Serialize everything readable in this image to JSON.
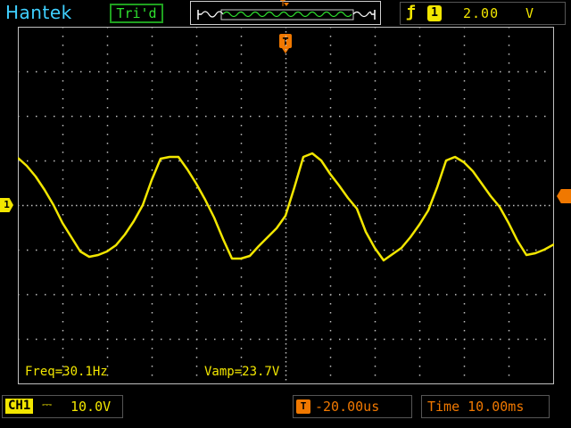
{
  "header": {
    "brand": "Hantek",
    "status": "Tri'd",
    "trigger_pos_icon": "T",
    "trigger": {
      "slope_icon": "rising-edge-icon",
      "slope_glyph": "ƒ",
      "channel": "1",
      "level": "2.00",
      "unit": "V"
    }
  },
  "screen": {
    "background": "#000000",
    "grid_color": "#bfbfbf",
    "trace_color": "#f2e600",
    "trace": [
      [
        0,
        147
      ],
      [
        10,
        156
      ],
      [
        20,
        168
      ],
      [
        30,
        183
      ],
      [
        40,
        200
      ],
      [
        50,
        220
      ],
      [
        60,
        236
      ],
      [
        70,
        252
      ],
      [
        80,
        258
      ],
      [
        90,
        256
      ],
      [
        100,
        252
      ],
      [
        110,
        245
      ],
      [
        120,
        233
      ],
      [
        130,
        218
      ],
      [
        140,
        200
      ],
      [
        150,
        172
      ],
      [
        160,
        148
      ],
      [
        170,
        146
      ],
      [
        180,
        146
      ],
      [
        190,
        160
      ],
      [
        200,
        176
      ],
      [
        210,
        194
      ],
      [
        220,
        214
      ],
      [
        230,
        238
      ],
      [
        240,
        260
      ],
      [
        250,
        260
      ],
      [
        260,
        257
      ],
      [
        270,
        246
      ],
      [
        280,
        236
      ],
      [
        290,
        226
      ],
      [
        300,
        212
      ],
      [
        310,
        180
      ],
      [
        320,
        146
      ],
      [
        330,
        142
      ],
      [
        340,
        150
      ],
      [
        350,
        165
      ],
      [
        360,
        178
      ],
      [
        370,
        192
      ],
      [
        380,
        204
      ],
      [
        390,
        230
      ],
      [
        400,
        248
      ],
      [
        410,
        262
      ],
      [
        420,
        255
      ],
      [
        430,
        248
      ],
      [
        440,
        236
      ],
      [
        450,
        222
      ],
      [
        460,
        206
      ],
      [
        470,
        180
      ],
      [
        480,
        150
      ],
      [
        490,
        146
      ],
      [
        500,
        152
      ],
      [
        510,
        162
      ],
      [
        520,
        176
      ],
      [
        530,
        190
      ],
      [
        540,
        202
      ],
      [
        550,
        220
      ],
      [
        560,
        240
      ],
      [
        570,
        256
      ],
      [
        580,
        254
      ],
      [
        590,
        250
      ],
      [
        601,
        244
      ]
    ]
  },
  "measurements": {
    "freq": "Freq=30.1Hz",
    "vamp": "Vamp=23.7V"
  },
  "markers": {
    "channel_label": "1",
    "trigger_pos_label": "T"
  },
  "footer": {
    "ch1_label": "CH1",
    "coupling_glyph": "⎓",
    "volts_per_div": "10.0V",
    "trigger_offset_icon": "T",
    "trigger_offset": "-20.00us",
    "timebase": "Time 10.00ms"
  }
}
